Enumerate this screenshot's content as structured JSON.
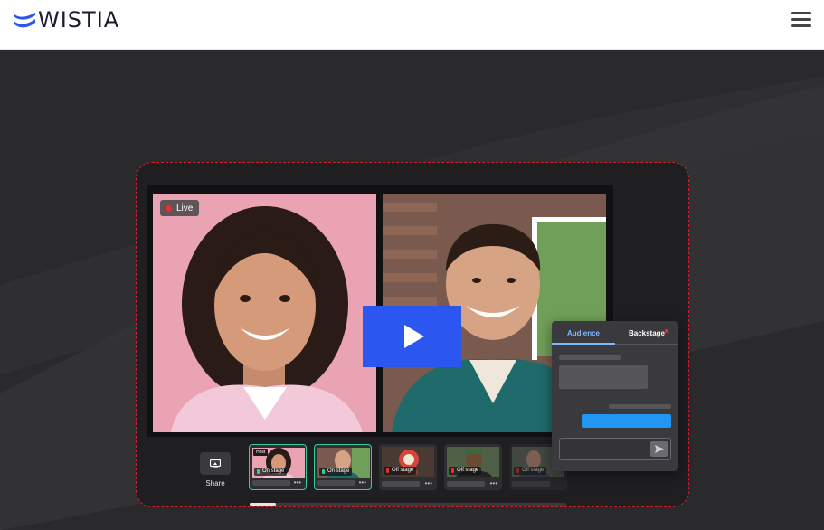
{
  "header": {
    "brand": "WISTIA",
    "menu_icon": "hamburger-menu-icon"
  },
  "colors": {
    "brand_blue": "#2b57f0",
    "hero_bg": "#2a2a2d",
    "frame_dash": "#d3202a",
    "live_red": "#e8302e",
    "on_stage_green": "#2fd39a",
    "chat_accent": "#7db9ff",
    "chat_message_blue": "#2196f3"
  },
  "stage": {
    "live_label": "Live",
    "play_icon": "play-icon"
  },
  "controls": {
    "share_label": "Share",
    "share_icon": "screen-share-icon"
  },
  "participants": [
    {
      "host_label": "Host",
      "status": "On stage"
    },
    {
      "status": "On stage"
    },
    {
      "status": "Off stage"
    },
    {
      "status": "Off stage"
    },
    {
      "status": "Off stage"
    }
  ],
  "chat": {
    "tabs": [
      "Audience",
      "Backstage"
    ],
    "send_icon": "send-icon"
  }
}
